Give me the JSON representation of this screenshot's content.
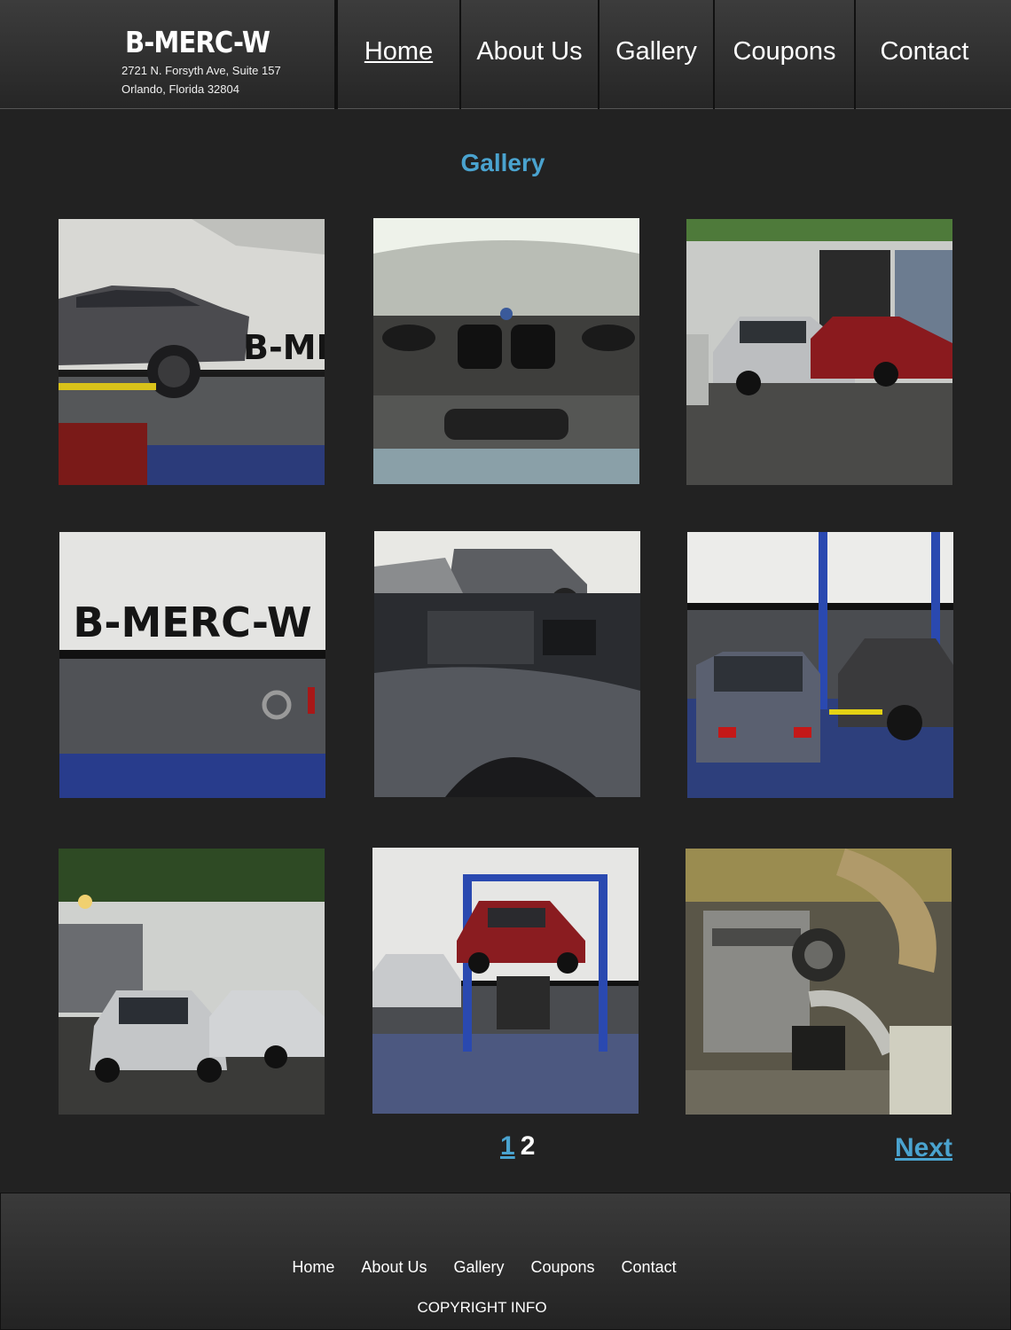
{
  "brand": {
    "name": "B-MERC-W",
    "address_line1": "2721 N. Forsyth Ave, Suite 157",
    "address_line2": "Orlando, Florida 32804"
  },
  "nav": {
    "items": [
      {
        "label": "Home",
        "active": true
      },
      {
        "label": "About Us",
        "active": false
      },
      {
        "label": "Gallery",
        "active": false
      },
      {
        "label": "Coupons",
        "active": false
      },
      {
        "label": "Contact",
        "active": false
      }
    ]
  },
  "page": {
    "title": "Gallery",
    "accent_color": "#4aa3cf"
  },
  "gallery": {
    "photos": [
      {
        "subject": "gray-bmw-on-lift-photo",
        "wall_text": "B-MER"
      },
      {
        "subject": "bmw-front-grille-photo"
      },
      {
        "subject": "bmws-parked-outside-photo"
      },
      {
        "subject": "shop-wall-logo-photo",
        "wall_text": "B-MERC-W"
      },
      {
        "subject": "open-engine-bay-photo"
      },
      {
        "subject": "shop-interior-lifts-photo"
      },
      {
        "subject": "silver-bmws-storefront-photo"
      },
      {
        "subject": "red-bmw-on-lift-photo"
      },
      {
        "subject": "engine-closeup-photo"
      }
    ]
  },
  "pagination": {
    "pages": [
      "1",
      "2"
    ],
    "current": "1",
    "next_label": "Next"
  },
  "footer": {
    "links": [
      "Home",
      "About Us",
      "Gallery",
      "Coupons",
      "Contact"
    ],
    "copyright": "COPYRIGHT INFO"
  }
}
